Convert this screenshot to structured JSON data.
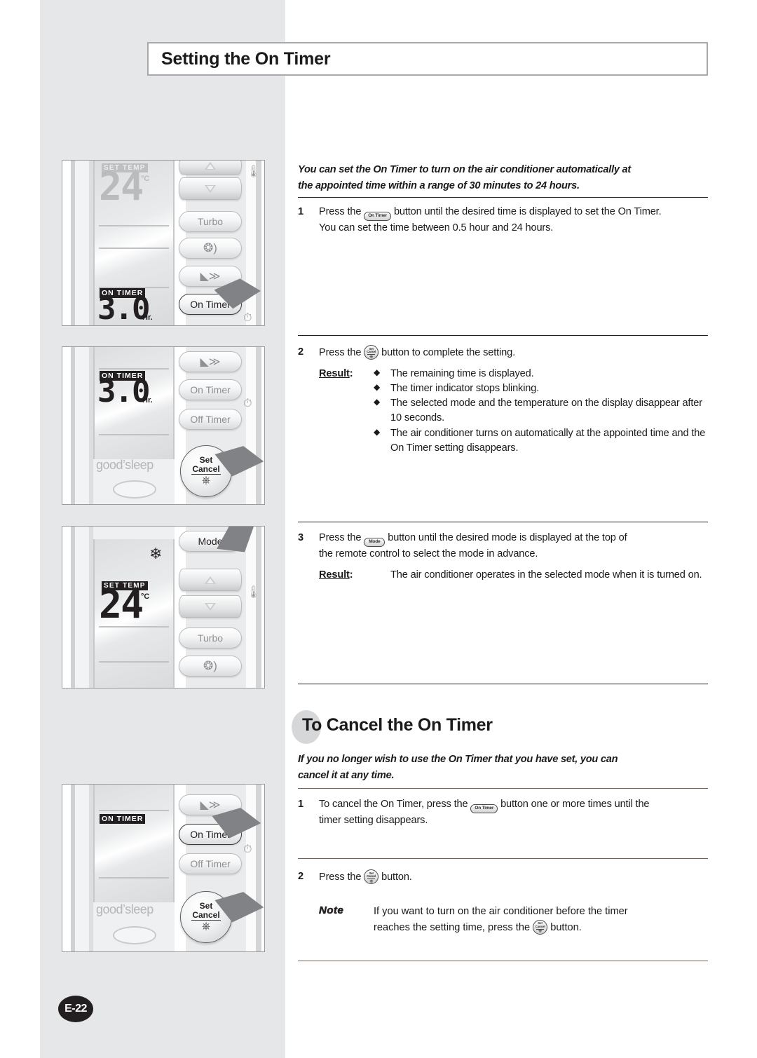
{
  "page": {
    "number_badge": "E-22",
    "title": "Setting the On Timer"
  },
  "main_section": {
    "intro_line1": "You can set the On Timer to turn on the air conditioner automatically at",
    "intro_line2": "the appointed time within a range of 30 minutes to 24 hours.",
    "steps": [
      {
        "number": "1",
        "text_before": "Press the",
        "key": "On Timer",
        "text_after": "button until the desired time is displayed to set the On Timer.",
        "text_line2": "You can set the time between 0.5 hour and 24 hours."
      },
      {
        "number": "2",
        "text_before": "Press the",
        "key_l1": "Set",
        "key_l2": "Cancel",
        "text_after": "button to complete the setting.",
        "result_label": "Result",
        "result_colon": ":",
        "bullets": [
          "The remaining time is displayed.",
          "The timer indicator stops blinking.",
          "The selected mode and the temperature on the display disappear after 10 seconds.",
          "The air conditioner turns on automatically at the appointed time and the On Timer setting disappears."
        ]
      },
      {
        "number": "3",
        "text_before": "Press the",
        "key": "Mode",
        "text_after": "button until the desired mode is displayed at the top of",
        "text_line2": "the remote control to select the mode in advance.",
        "result_label": "Result",
        "result_colon": ":",
        "result_text": "The air conditioner operates in the selected mode when it is turned on."
      }
    ]
  },
  "cancel_section": {
    "heading_first": "To",
    "heading_rest": "Cancel the On Timer",
    "intro_line1": "If you no longer wish to use the On Timer that you have set, you can",
    "intro_line2": "cancel it at any time.",
    "steps": [
      {
        "number": "1",
        "text_before": "To cancel the On Timer, press the",
        "key": "On Timer",
        "text_after": "button one or more times until the",
        "text_line2": "timer setting disappears."
      },
      {
        "number": "2",
        "text_before": "Press the",
        "key_l1": "Set",
        "key_l2": "Cancel",
        "text_after": "button."
      }
    ],
    "note": {
      "label": "Note",
      "line1_before": "If you want to turn on the air conditioner before the timer",
      "line2_before": "reaches the setting time, press the",
      "key_l1": "Set",
      "key_l2": "Cancel",
      "line2_after": "button."
    }
  },
  "figures": [
    {
      "id": "fig-1-on-timer-press",
      "lcd": {
        "set_temp_label": "SET TEMP",
        "temperature": "24",
        "temp_unit": "°C",
        "on_timer_label": "ON TIMER",
        "timer_value": "3.0",
        "timer_unit": "Hr."
      },
      "buttons": [
        "Turbo",
        "On Timer"
      ],
      "icons": [
        "thermometer-icon",
        "fan-icon",
        "airflow-icon",
        "clock-icon"
      ],
      "highlighted_button": "On Timer"
    },
    {
      "id": "fig-2-set-cancel-press",
      "lcd": {
        "on_timer_label": "ON TIMER",
        "timer_value": "3.0",
        "timer_unit": "Hr.",
        "brand_text": "good’sleep"
      },
      "buttons": [
        "On Timer",
        "Off Timer",
        "Set",
        "Cancel"
      ],
      "icons": [
        "airflow-icon",
        "clock-icon",
        "power-icon"
      ],
      "highlighted_button": "Set Cancel"
    },
    {
      "id": "fig-3-mode-press",
      "lcd": {
        "mode_icon": "snowflake-icon",
        "set_temp_label": "SET TEMP",
        "temperature": "24",
        "temp_unit": "°C"
      },
      "buttons": [
        "Mode",
        "Turbo"
      ],
      "icons": [
        "thermometer-icon",
        "fan-icon",
        "up-arrow-icon",
        "down-arrow-icon"
      ],
      "highlighted_button": "Mode"
    },
    {
      "id": "fig-4-cancel-on-timer",
      "lcd": {
        "on_timer_label": "ON TIMER",
        "brand_text": "good’sleep"
      },
      "buttons": [
        "On Timer",
        "Off Timer",
        "Set",
        "Cancel"
      ],
      "icons": [
        "airflow-icon",
        "clock-icon",
        "power-icon"
      ],
      "highlighted_button": "On Timer"
    }
  ],
  "colors": {
    "band_gray": "#e6e7e8",
    "title_border": "#a7a9ac",
    "text_dark": "#1a1a1a",
    "badge_bg": "#231f20",
    "oval_gray": "#d6d7d9"
  }
}
